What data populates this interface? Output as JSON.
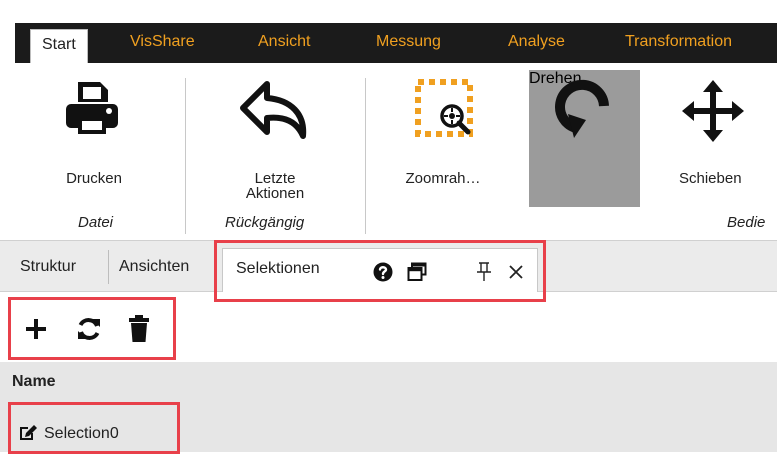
{
  "menu": {
    "tabs": [
      "Start",
      "VisShare",
      "Ansicht",
      "Messung",
      "Analyse",
      "Transformation"
    ],
    "active": "Start"
  },
  "ribbon": {
    "print": "Drucken",
    "undo_line1": "Letzte",
    "undo_line2": "Aktionen",
    "zoom": "Zoomrah…",
    "rotate": "Drehen",
    "move": "Schieben",
    "group_file": "Datei",
    "group_undo": "Rückgängig",
    "group_operate": "Bedie"
  },
  "panel": {
    "tabs": [
      "Struktur",
      "Ansichten"
    ],
    "active_tab": "Selektionen"
  },
  "list": {
    "column_header": "Name",
    "items": [
      "Selection0"
    ]
  },
  "colors": {
    "accent": "#f0a020",
    "highlight": "#e8404a",
    "menubar": "#1b1b1b",
    "active_button": "#9b9b9b"
  }
}
